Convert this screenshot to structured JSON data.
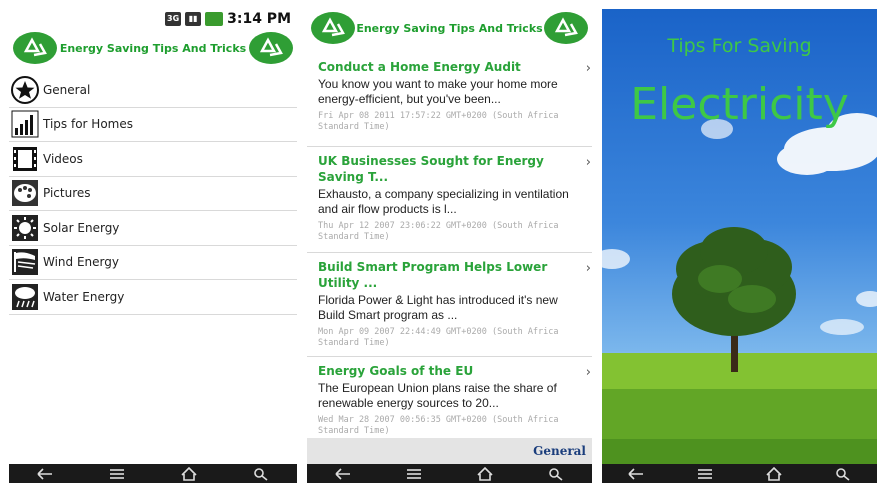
{
  "status_bar": {
    "network": "3G",
    "time": "3:14 PM"
  },
  "app": {
    "title": "Energy Saving Tips And Tricks"
  },
  "menu": [
    {
      "label": "General",
      "icon": "star-icon"
    },
    {
      "label": "Tips for Homes",
      "icon": "bar-chart-icon"
    },
    {
      "label": "Videos",
      "icon": "film-icon"
    },
    {
      "label": "Pictures",
      "icon": "palette-icon"
    },
    {
      "label": "Solar Energy",
      "icon": "sun-icon"
    },
    {
      "label": "Wind Energy",
      "icon": "wind-icon"
    },
    {
      "label": "Water Energy",
      "icon": "rain-icon"
    }
  ],
  "articles": [
    {
      "title": "Conduct a Home Energy Audit",
      "body": "You know you want to make your home more energy-efficient, but you've been...",
      "date": "Fri Apr 08 2011 17:57:22 GMT+0200 (South Africa Standard Time)"
    },
    {
      "title": "UK Businesses Sought for Energy Saving T...",
      "body": "Exhausto, a company specializing in ventilation and air flow products is l...",
      "date": "Thu Apr 12 2007 23:06:22 GMT+0200 (South Africa Standard Time)"
    },
    {
      "title": "Build Smart Program Helps Lower Utility ...",
      "body": "Florida Power & Light has introduced it's new Build Smart program as ...",
      "date": "Mon Apr 09 2007 22:44:49 GMT+0200 (South Africa Standard Time)"
    },
    {
      "title": "Energy Goals of the EU",
      "body": "The European Union plans raise the share of renewable energy sources to 20...",
      "date": "Wed Mar 28 2007 00:56:35 GMT+0200 (South Africa Standard Time)"
    }
  ],
  "footer_tab": "General",
  "splash": {
    "subtitle": "Tips For Saving",
    "title": "Electricity"
  },
  "colors": {
    "brand_green": "#1e9e2e",
    "link_green": "#2aa33a",
    "navbar": "#1a1a1a",
    "footer_link": "#1a3d7c"
  },
  "nav_icons": [
    "back-icon",
    "menu-icon",
    "home-icon",
    "search-icon"
  ]
}
